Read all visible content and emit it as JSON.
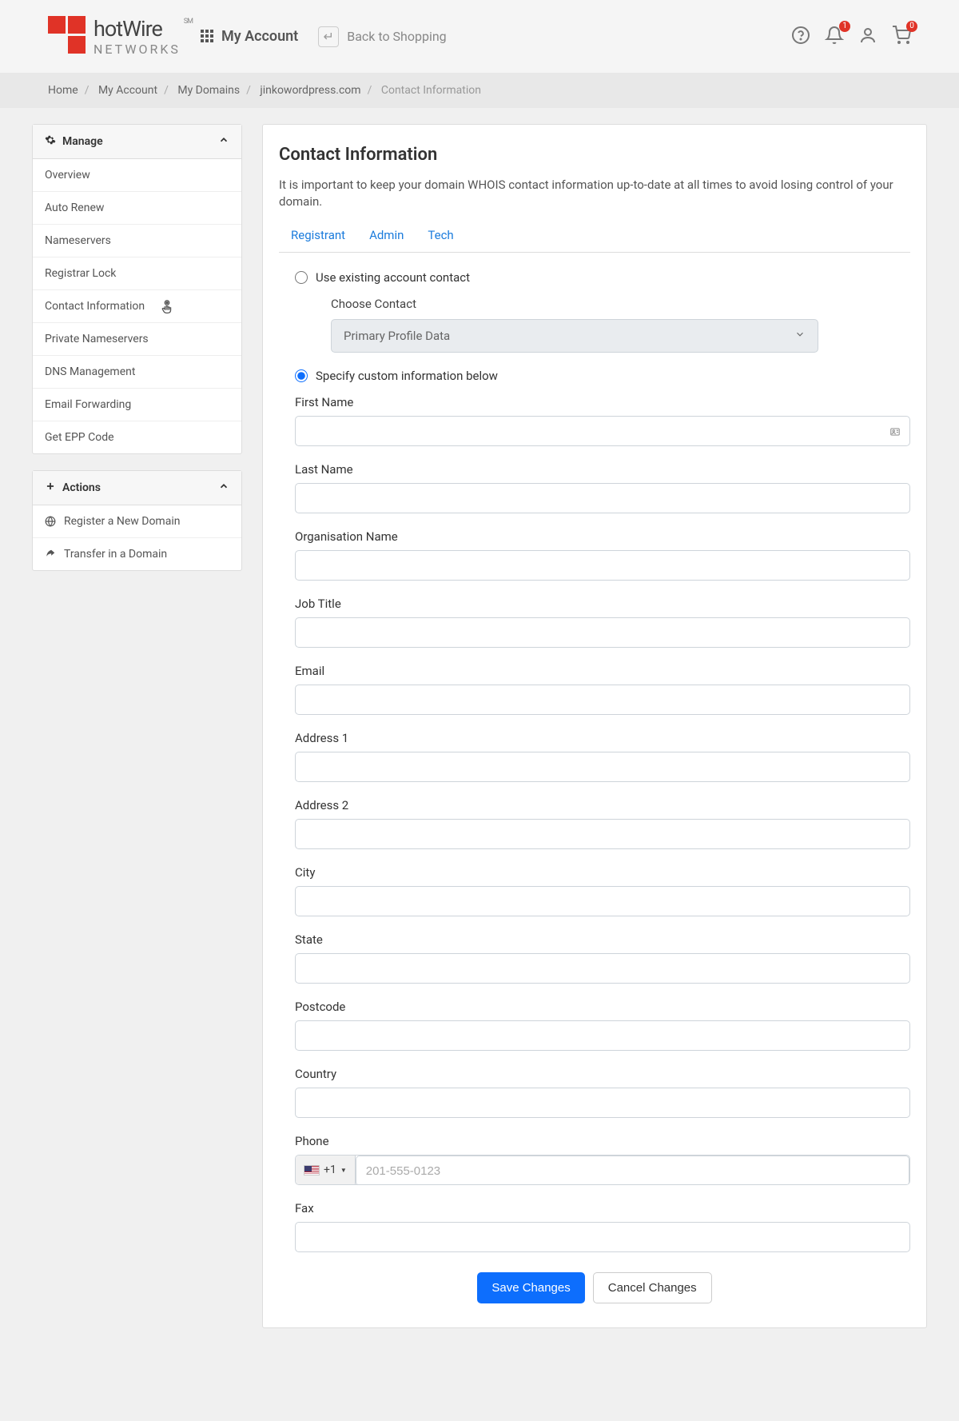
{
  "header": {
    "brand": "hotWire",
    "brand_sub": "NETWORKS",
    "brand_sm": "SM",
    "my_account": "My Account",
    "back_shopping": "Back to Shopping",
    "bell_badge": "1",
    "cart_badge": "0"
  },
  "breadcrumb": {
    "home": "Home",
    "my_account": "My Account",
    "my_domains": "My Domains",
    "domain": "jinkowordpress.com",
    "active": "Contact Information"
  },
  "sidebar": {
    "manage_title": "Manage",
    "manage_items": [
      "Overview",
      "Auto Renew",
      "Nameservers",
      "Registrar Lock",
      "Contact Information",
      "Private Nameservers",
      "DNS Management",
      "Email Forwarding",
      "Get EPP Code"
    ],
    "actions_title": "Actions",
    "actions": {
      "register": "Register a New Domain",
      "transfer": "Transfer in a Domain"
    }
  },
  "content": {
    "title": "Contact Information",
    "intro": "It is important to keep your domain WHOIS contact information up-to-date at all times to avoid losing control of your domain.",
    "tabs": {
      "registrant": "Registrant",
      "admin": "Admin",
      "tech": "Tech"
    },
    "radio_existing": "Use existing account contact",
    "choose_contact_label": "Choose Contact",
    "choose_contact_value": "Primary Profile Data",
    "radio_custom": "Specify custom information below",
    "fields": {
      "first_name": "First Name",
      "last_name": "Last Name",
      "org": "Organisation Name",
      "job_title": "Job Title",
      "email": "Email",
      "address1": "Address 1",
      "address2": "Address 2",
      "city": "City",
      "state": "State",
      "postcode": "Postcode",
      "country": "Country",
      "phone": "Phone",
      "fax": "Fax"
    },
    "phone_prefix": "+1",
    "phone_placeholder": "201-555-0123",
    "save": "Save Changes",
    "cancel": "Cancel Changes"
  }
}
